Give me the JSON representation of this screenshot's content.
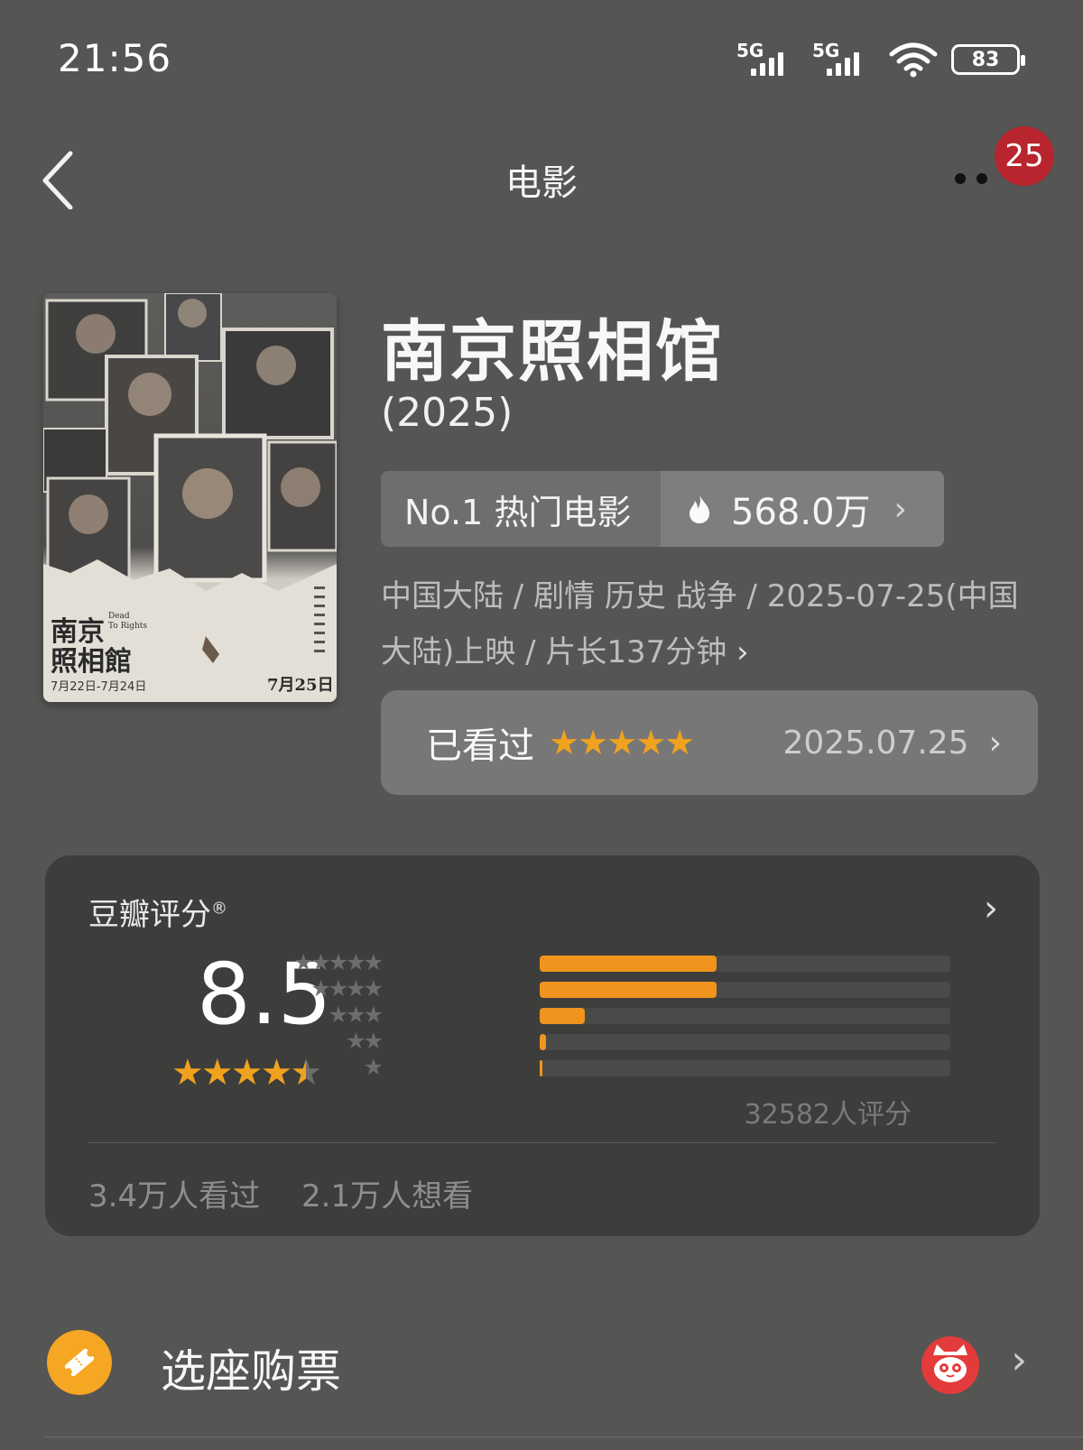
{
  "status_bar": {
    "time": "21:56",
    "signal1_label": "5G",
    "signal2_label": "5G",
    "battery": "83"
  },
  "header": {
    "title": "电影",
    "badge_count": "25"
  },
  "movie": {
    "title": "南京照相馆",
    "year": "(2025)",
    "rank_label": "No.1 热门电影",
    "heat_value": "568.0万",
    "meta_line": "中国大陆 / 剧情 历史 战争 / 2025-07-25(中国大陆)上映 / 片长137分钟",
    "poster": {
      "title": "南京照相馆",
      "subtitle": "Dead To Rights",
      "dates_left": "7月22日-7月24日",
      "date_right": "7月25日"
    }
  },
  "watched": {
    "label": "已看过",
    "stars": 5,
    "date": "2025.07.25"
  },
  "rating": {
    "title": "豆瓣评分",
    "registered_mark": "®",
    "score": "8.5",
    "stars_value": 4.5,
    "distribution": [
      {
        "stars": 5,
        "percent": 43
      },
      {
        "stars": 4,
        "percent": 43
      },
      {
        "stars": 3,
        "percent": 11
      },
      {
        "stars": 2,
        "percent": 1.5
      },
      {
        "stars": 1,
        "percent": 0.5
      }
    ],
    "count": "32582人评分",
    "watched_count": "3.4万人看过",
    "want_count": "2.1万人想看"
  },
  "ticket": {
    "label": "选座购票"
  },
  "colors": {
    "background": "#555554",
    "accent_orange": "#f0a21e",
    "badge_red": "#b8252f",
    "card_bg": "#3d3d3c"
  },
  "icons": [
    "back-chevron-icon",
    "more-dots-icon",
    "fire-icon",
    "chevron-right-icon",
    "star-icon",
    "ticket-icon",
    "cat-logo-icon",
    "signal-icon",
    "wifi-icon",
    "battery-icon"
  ]
}
